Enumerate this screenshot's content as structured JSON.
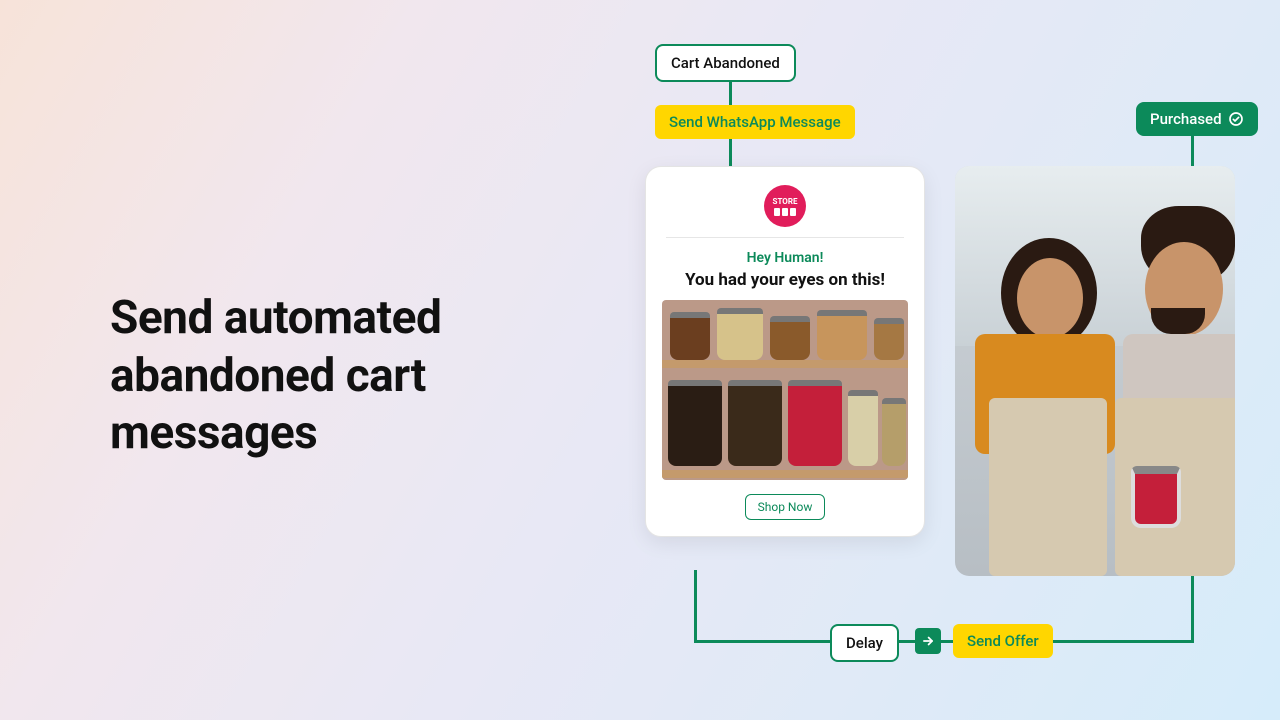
{
  "hero": {
    "headline": "Send automated abandoned cart messages"
  },
  "flow": {
    "trigger": "Cart Abandoned",
    "action_send": "Send WhatsApp Message",
    "delay": "Delay",
    "send_offer": "Send Offer",
    "purchased": "Purchased"
  },
  "message": {
    "logo_label": "STORE",
    "greeting": "Hey Human!",
    "subject": "You had your eyes on this!",
    "cta": "Shop Now"
  },
  "colors": {
    "accent_green": "#0c8a5a",
    "accent_yellow": "#ffd600",
    "brand_pink": "#e11d5b"
  }
}
